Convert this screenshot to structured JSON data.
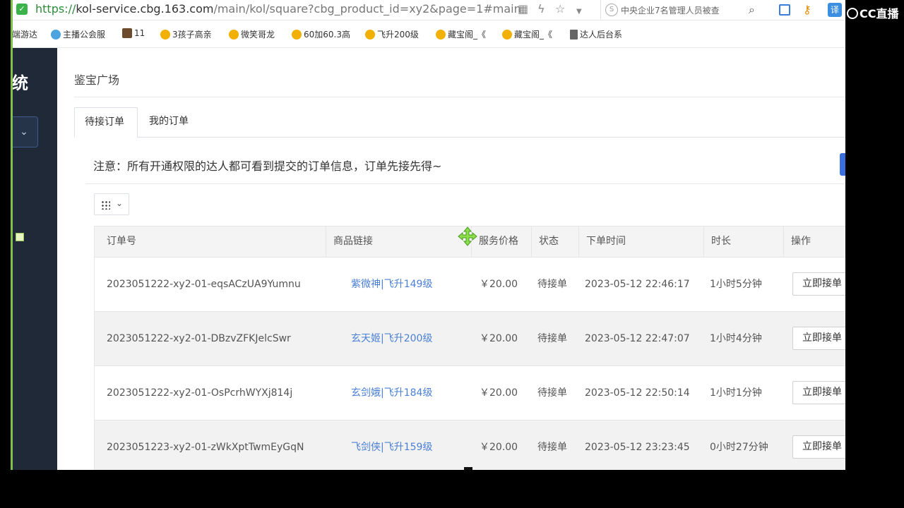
{
  "browser": {
    "url_protocol": "https://",
    "url_host": "kol-service.cbg.163.com",
    "url_path": "/main/kol/square?cbg_product_id=xy2&page=1#main",
    "news_ticker": "中央企业7名管理人员被查",
    "ext_translate_label": "译"
  },
  "bookmarks": [
    {
      "label": "端游达",
      "icon": "none"
    },
    {
      "label": "主播公会服",
      "icon": "cloud-icon"
    },
    {
      "label": "11",
      "icon": "image-icon"
    },
    {
      "label": "3孩子高亲",
      "icon": "star-icon"
    },
    {
      "label": "微笑哥龙",
      "icon": "star-icon"
    },
    {
      "label": "60加60.3高",
      "icon": "star-icon"
    },
    {
      "label": "飞升200级",
      "icon": "star-icon"
    },
    {
      "label": "藏宝阁_《",
      "icon": "star-icon"
    },
    {
      "label": "藏宝阁_《",
      "icon": "star-icon"
    },
    {
      "label": "达人后台系",
      "icon": "doc-icon"
    }
  ],
  "sidebar": {
    "title_fragment": "统",
    "select_icon": "chevron-down-icon"
  },
  "page": {
    "title": "鉴宝广场",
    "tabs": [
      {
        "label": "待接订单",
        "active": true
      },
      {
        "label": "我的订单",
        "active": false
      }
    ],
    "notice": "注意：所有开通权限的达人都可看到提交的订单信息，订单先接先得~"
  },
  "table": {
    "columns": [
      "订单号",
      "商品链接",
      "服务价格",
      "状态",
      "下单时间",
      "时长",
      "操作"
    ],
    "rows": [
      {
        "order_id": "2023051222-xy2-01-eqsACzUA9Yumnu",
        "product": "紫微神|飞升149级",
        "price": "￥20.00",
        "status": "待接单",
        "time": "2023-05-12 22:46:17",
        "duration": "1小时5分钟",
        "action": "立即接单"
      },
      {
        "order_id": "2023051222-xy2-01-DBzvZFKJelcSwr",
        "product": "玄天姬|飞升200级",
        "price": "￥20.00",
        "status": "待接单",
        "time": "2023-05-12 22:47:07",
        "duration": "1小时4分钟",
        "action": "立即接单"
      },
      {
        "order_id": "2023051222-xy2-01-OsPcrhWYXj814j",
        "product": "玄剑娥|飞升184级",
        "price": "￥20.00",
        "status": "待接单",
        "time": "2023-05-12 22:50:14",
        "duration": "1小时1分钟",
        "action": "立即接单"
      },
      {
        "order_id": "2023051223-xy2-01-zWkXptTwmEyGqN",
        "product": "飞剑侠|飞升159级",
        "price": "￥20.00",
        "status": "待接单",
        "time": "2023-05-12 23:23:45",
        "duration": "0小时27分钟",
        "action": "立即接单"
      }
    ]
  },
  "overlay": {
    "watermark": "CC直播"
  },
  "colors": {
    "sidebar_bg": "#1f2937",
    "link": "#4a7fd6",
    "primary": "#3a6fe0"
  }
}
